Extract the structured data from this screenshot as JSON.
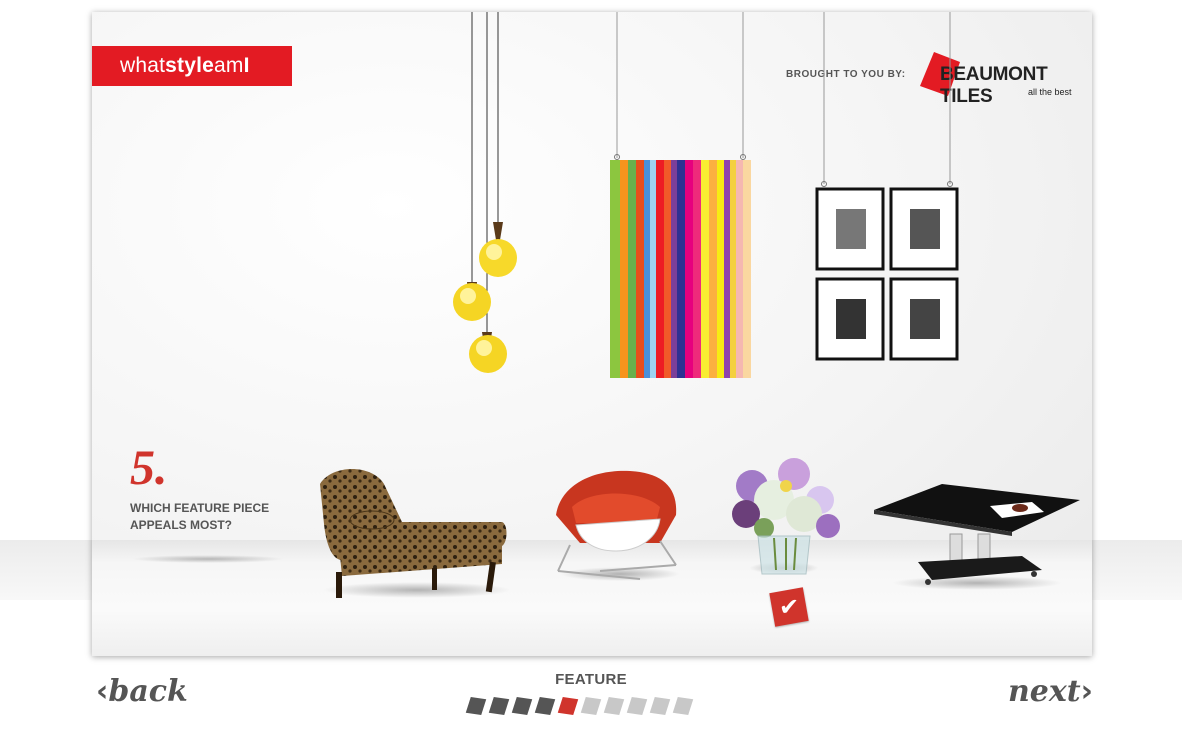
{
  "brand": {
    "pre": "what",
    "bold": "style",
    "post": "am",
    "last": "I"
  },
  "sponsor": {
    "label": "BROUGHT TO YOU BY:",
    "name": "BEAUMONT TILES",
    "tagline": "all the best"
  },
  "question": {
    "number": "5.",
    "text": "WHICH FEATURE PIECE APPEALS MOST?"
  },
  "options": [
    {
      "name": "leopard chaise lounge",
      "selected": false
    },
    {
      "name": "red modern lounge chair",
      "selected": false
    },
    {
      "name": "flower arrangement vase",
      "selected": true
    },
    {
      "name": "black glass coffee table",
      "selected": false
    }
  ],
  "decor": [
    "pendant lights",
    "striped artwork",
    "framed photographs"
  ],
  "navigation": {
    "back_label": "back",
    "next_label": "next"
  },
  "step": {
    "label": "FEATURE",
    "current": 5,
    "total": 10
  },
  "colors": {
    "accent": "#e31b23",
    "check": "#d0342c",
    "text": "#555555"
  }
}
